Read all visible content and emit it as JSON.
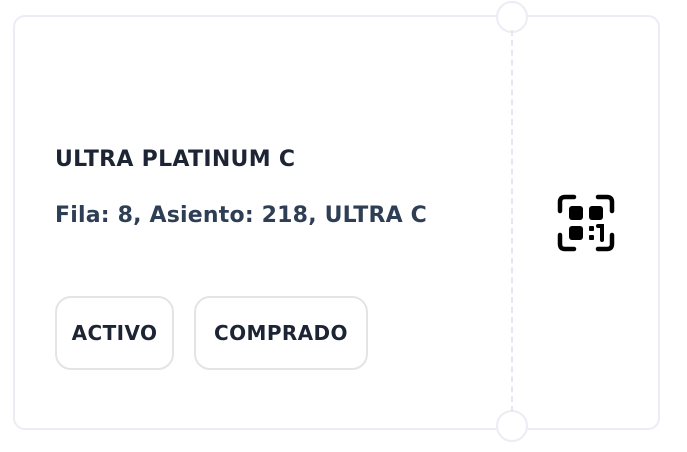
{
  "ticket": {
    "title": "ULTRA PLATINUM C",
    "seat": "Fila: 8, Asiento: 218, ULTRA C",
    "status": "ACTIVO",
    "purchase_status": "COMPRADO"
  },
  "icons": {
    "qr": "qr-code-scan-icon"
  },
  "colors": {
    "text_primary": "#1d2433",
    "text_secondary": "#2e3e55",
    "border": "#ececf4"
  }
}
